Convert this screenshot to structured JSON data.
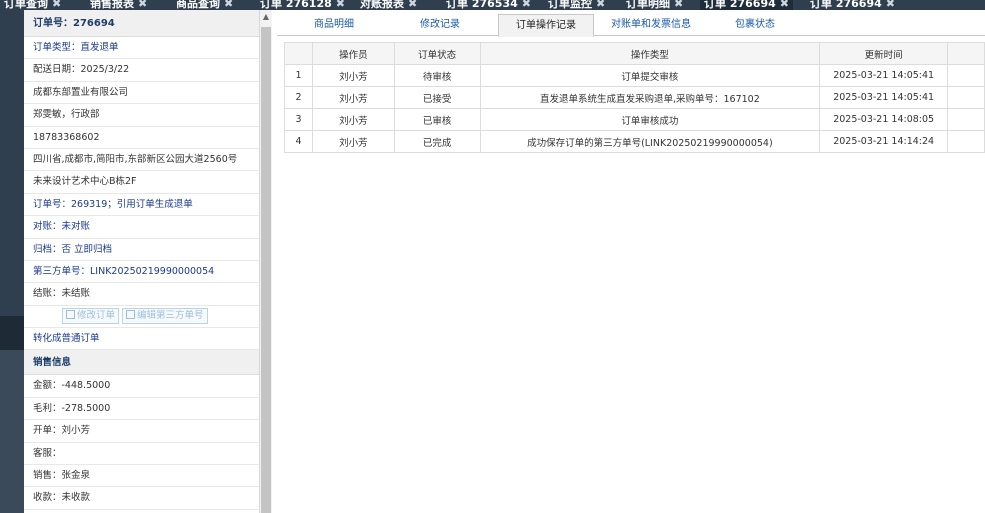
{
  "top_tabs": [
    {
      "label": "订单查询",
      "close": "✖"
    },
    {
      "label": "销售报表",
      "close": "✖"
    },
    {
      "label": "商品查询",
      "close": "✖"
    },
    {
      "label": "订单 276128",
      "close": "✖"
    },
    {
      "label": "对账报表",
      "close": "✖"
    },
    {
      "label": "订单 276534",
      "close": "✖"
    },
    {
      "label": "订单监控",
      "close": "✖"
    },
    {
      "label": "订单明细",
      "close": "✖"
    },
    {
      "label": "订单 276694",
      "close": "✖"
    },
    {
      "label": "订单 276694",
      "close": "✖"
    }
  ],
  "left": {
    "order_no": "订单号：276694",
    "rows": [
      {
        "text": "订单类型：直发退单",
        "blue": true
      },
      {
        "text": "配送日期：2025/3/22",
        "blue": false
      },
      {
        "text": "成都东部置业有限公司",
        "blue": false
      },
      {
        "text": "郑雯敏，行政部",
        "blue": false
      },
      {
        "text": "18783368602",
        "blue": false
      },
      {
        "text": "四川省,成都市,简阳市,东部新区公园大道2560号",
        "blue": false
      },
      {
        "text": "未来设计艺术中心B栋2F",
        "blue": false
      },
      {
        "text": "订单号：269319；引用订单生成退单",
        "blue": true
      },
      {
        "text": "对账：未对账",
        "blue": true
      },
      {
        "text": "归档：否 立即归档",
        "blue": true
      },
      {
        "text": "第三方单号：LINK20250219990000054",
        "blue": true
      },
      {
        "text": "结账：未结账",
        "blue": false
      }
    ],
    "btn_edit_order": "修改订单",
    "btn_edit_third": "编辑第三方单号",
    "convert_link": "转化成普通订单",
    "sales_header": "销售信息",
    "sales_rows": [
      "金额：-448.5000",
      "毛利：-278.5000",
      "开单：刘小芳",
      "客服：",
      "销售：张金泉",
      "收款：未收款"
    ]
  },
  "tabs": [
    "商品明细",
    "修改记录",
    "订单操作记录",
    "对账单和发票信息",
    "包裹状态"
  ],
  "active_tab": 2,
  "table": {
    "headers": [
      "",
      "操作员",
      "订单状态",
      "操作类型",
      "更新时间"
    ],
    "rows": [
      [
        "1",
        "刘小芳",
        "待审核",
        "订单提交审核",
        "2025-03-21 14:05:41"
      ],
      [
        "2",
        "刘小芳",
        "已接受",
        "直发退单系统生成直发采购退单,采购单号：167102",
        "2025-03-21 14:05:41"
      ],
      [
        "3",
        "刘小芳",
        "已审核",
        "订单审核成功",
        "2025-03-21 14:08:05"
      ],
      [
        "4",
        "刘小芳",
        "已完成",
        "成功保存订单的第三方单号(LINK20250219990000054)",
        "2025-03-21 14:14:24"
      ]
    ]
  }
}
